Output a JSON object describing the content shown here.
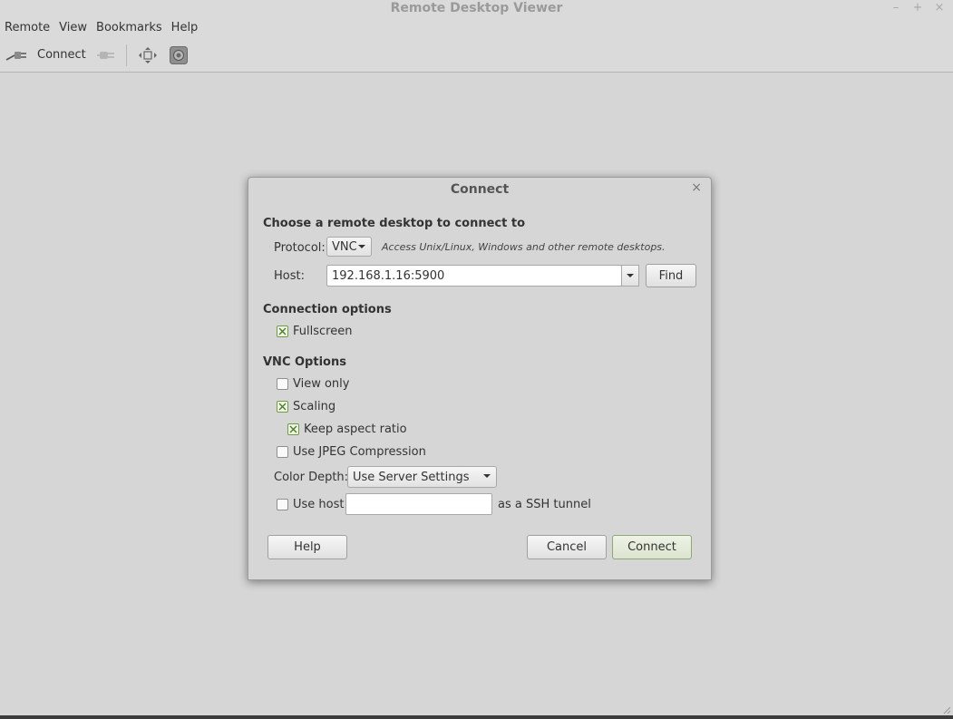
{
  "window": {
    "title": "Remote Desktop Viewer",
    "controls": {
      "minimize": "–",
      "maximize": "+",
      "close": "×"
    }
  },
  "menubar": {
    "items": [
      "Remote",
      "View",
      "Bookmarks",
      "Help"
    ]
  },
  "toolbar": {
    "connect_label": "Connect",
    "icons": [
      "connect-plug-icon",
      "disconnect-plug-icon",
      "fit-window-icon",
      "screenshot-icon"
    ]
  },
  "dialog": {
    "title": "Connect",
    "close": "×",
    "choose_heading": "Choose a remote desktop to connect to",
    "protocol": {
      "label": "Protocol:",
      "value": "VNC",
      "description": "Access Unix/Linux, Windows and other remote desktops."
    },
    "host": {
      "label": "Host:",
      "value": "192.168.1.16:5900",
      "find_label": "Find"
    },
    "connection_options": {
      "heading": "Connection options",
      "fullscreen": {
        "label": "Fullscreen",
        "checked": true
      }
    },
    "vnc_options": {
      "heading": "VNC Options",
      "view_only": {
        "label": "View only",
        "checked": false
      },
      "scaling": {
        "label": "Scaling",
        "checked": true
      },
      "keep_aspect": {
        "label": "Keep aspect ratio",
        "checked": true
      },
      "jpeg": {
        "label": "Use JPEG Compression",
        "checked": false
      },
      "color_depth": {
        "label": "Color Depth:",
        "value": "Use Server Settings"
      },
      "ssh": {
        "label": "Use host",
        "checked": false,
        "value": "",
        "suffix": "as a SSH tunnel"
      }
    },
    "buttons": {
      "help": "Help",
      "cancel": "Cancel",
      "connect": "Connect"
    }
  },
  "colors": {
    "background": "#d6d6d6",
    "check_accent": "#6f9b48",
    "default_button_border": "#8fa77a"
  }
}
